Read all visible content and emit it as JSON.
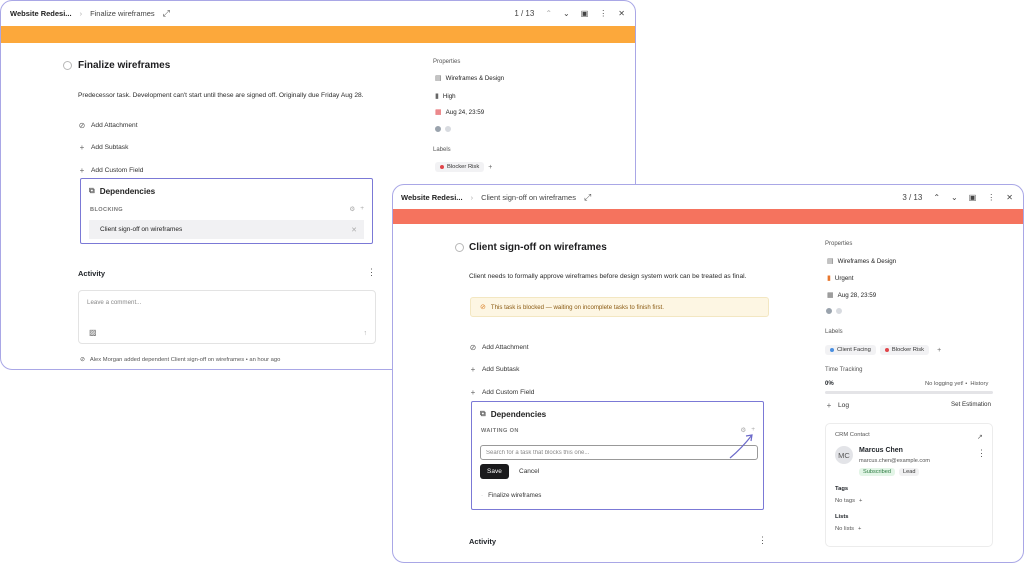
{
  "colors": {
    "accent": "#7b79d6",
    "banner_back": "#fca83b",
    "banner_front": "#f5735e",
    "blocker": "#e0454a",
    "client_facing": "#4a8fe0",
    "urgent": "#e8772e",
    "due_date": "#e0454a"
  },
  "back": {
    "header": {
      "project": "Website Redesi...",
      "task": "Finalize wireframes",
      "pager": "1 / 13"
    },
    "task": {
      "title": "Finalize wireframes",
      "description": "Predecessor task. Development can't start until these are signed off. Originally due Friday Aug 28."
    },
    "actions": {
      "attachment": "Add Attachment",
      "subtask": "Add Subtask",
      "custom_field": "Add Custom Field"
    },
    "dependencies": {
      "title": "Dependencies",
      "section": "BLOCKING",
      "items": [
        "Client sign-off on wireframes"
      ]
    },
    "activity": {
      "title": "Activity",
      "placeholder": "Leave a comment...",
      "log": "Alex Morgan added dependent Client sign-off on wireframes • an hour ago"
    },
    "properties": {
      "title": "Properties",
      "project": "Wireframes & Design",
      "priority": "High",
      "due": "Aug 24, 23:59"
    },
    "labels": {
      "title": "Labels",
      "items": [
        "Blocker Risk"
      ]
    }
  },
  "front": {
    "header": {
      "project": "Website Redesi...",
      "task": "Client sign-off on wireframes",
      "pager": "3 / 13"
    },
    "task": {
      "title": "Client sign-off on wireframes",
      "description": "Client needs to formally approve wireframes before design system work can be treated as final."
    },
    "blocked_notice": "This task is blocked — waiting on incomplete tasks to finish first.",
    "actions": {
      "attachment": "Add Attachment",
      "subtask": "Add Subtask",
      "custom_field": "Add Custom Field"
    },
    "dependencies": {
      "title": "Dependencies",
      "section": "WAITING ON",
      "search_placeholder": "Search for a task that blocks this one...",
      "save_label": "Save",
      "cancel_label": "Cancel",
      "suggestions": [
        "Finalize wireframes"
      ]
    },
    "activity": {
      "title": "Activity"
    },
    "properties": {
      "title": "Properties",
      "project": "Wireframes & Design",
      "priority": "Urgent",
      "due": "Aug 28, 23:59"
    },
    "labels": {
      "title": "Labels",
      "items": [
        "Client Facing",
        "Blocker Risk"
      ]
    },
    "time_tracking": {
      "title": "Time Tracking",
      "percent": "0%",
      "progress": 0,
      "status": "No logging yet! •",
      "history": "History",
      "log": "Log",
      "estimate": "Set Estimation"
    },
    "crm": {
      "title": "CRM Contact",
      "initials": "MC",
      "name": "Marcus Chen",
      "email": "marcus.chen@example.com",
      "badges": [
        "Subscribed",
        "Lead"
      ],
      "tags_title": "Tags",
      "no_tags": "No tags",
      "lists_title": "Lists",
      "no_lists": "No lists"
    }
  }
}
